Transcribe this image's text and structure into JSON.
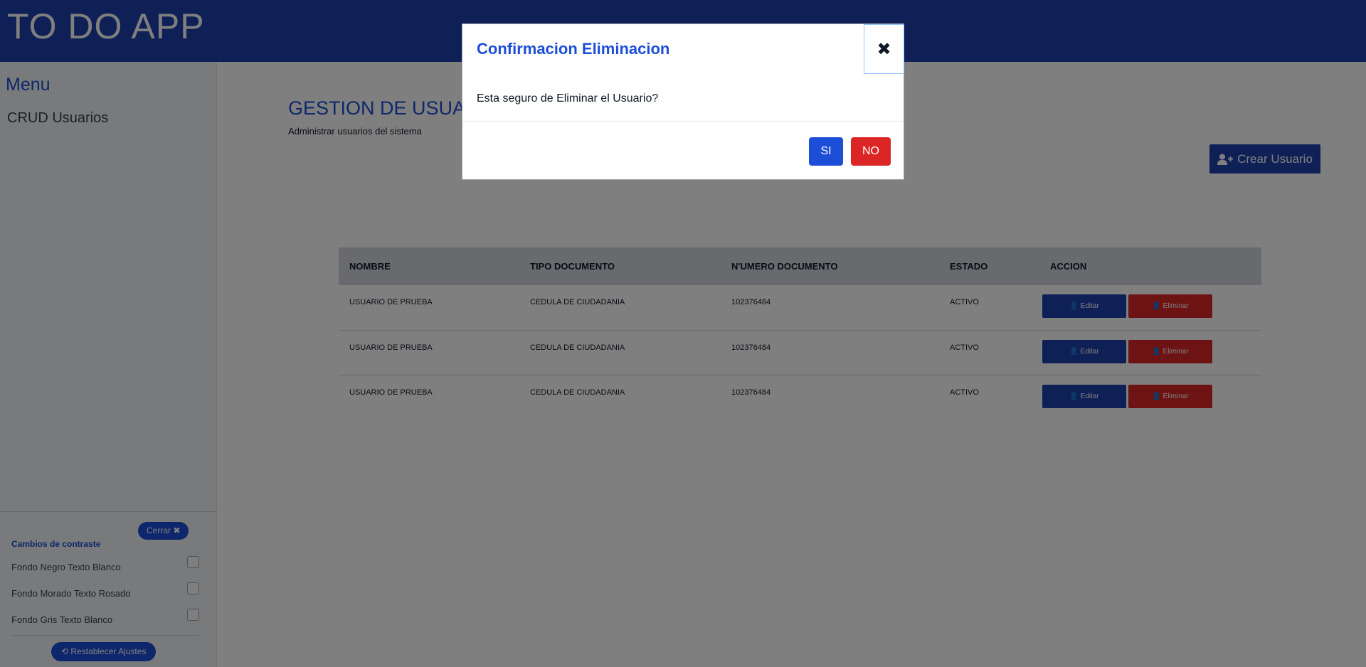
{
  "app": {
    "title": "TO DO APP"
  },
  "sidebar": {
    "menu_title": "Menu",
    "items": [
      {
        "label": "CRUD Usuarios"
      }
    ]
  },
  "contrast": {
    "close_label": "Cerrar ✖",
    "title": "Cambios de contraste",
    "options": [
      {
        "label": "Fondo Negro Texto Blanco",
        "checked": false
      },
      {
        "label": "Fondo Morado Texto Rosado",
        "checked": false
      },
      {
        "label": "Fondo Gris Texto Blanco",
        "checked": false
      }
    ],
    "reset_label": "⟲ Restablecer Ajustes"
  },
  "page": {
    "title": "GESTION DE USUARIOS",
    "subtitle": "Administrar usuarios del sistema",
    "create_button": "Crear Usuario"
  },
  "table": {
    "headers": [
      "NOMBRE",
      "TIPO DOCUMENTO",
      "N'UMERO DOCUMENTO",
      "ESTADO",
      "ACCION"
    ],
    "rows": [
      {
        "nombre": "USUARIO DE PRUEBA",
        "tipo": "CEDULA DE CIUDADANIA",
        "numero": "102376484",
        "estado": "ACTIVO"
      },
      {
        "nombre": "USUARIO DE PRUEBA",
        "tipo": "CEDULA DE CIUDADANIA",
        "numero": "102376484",
        "estado": "ACTIVO"
      },
      {
        "nombre": "USUARIO DE PRUEBA",
        "tipo": "CEDULA DE CIUDADANIA",
        "numero": "102376484",
        "estado": "ACTIVO"
      }
    ],
    "edit_label": "Editar",
    "delete_label": "Eliminar"
  },
  "modal": {
    "title": "Confirmacion Eliminacion",
    "close_symbol": "✖",
    "body": "Esta seguro de Eliminar el Usuario?",
    "yes_label": "SI",
    "no_label": "NO"
  },
  "colors": {
    "primary": "#1e40af",
    "accent": "#1d4ed8",
    "danger": "#dc2626",
    "overlay": "rgba(0,0,0,0.5)"
  },
  "icons": {
    "add_user": "add-user-icon",
    "edit_user": "edit-user-icon",
    "delete_user": "delete-user-icon",
    "reset": "reset-icon",
    "close": "close-icon"
  }
}
